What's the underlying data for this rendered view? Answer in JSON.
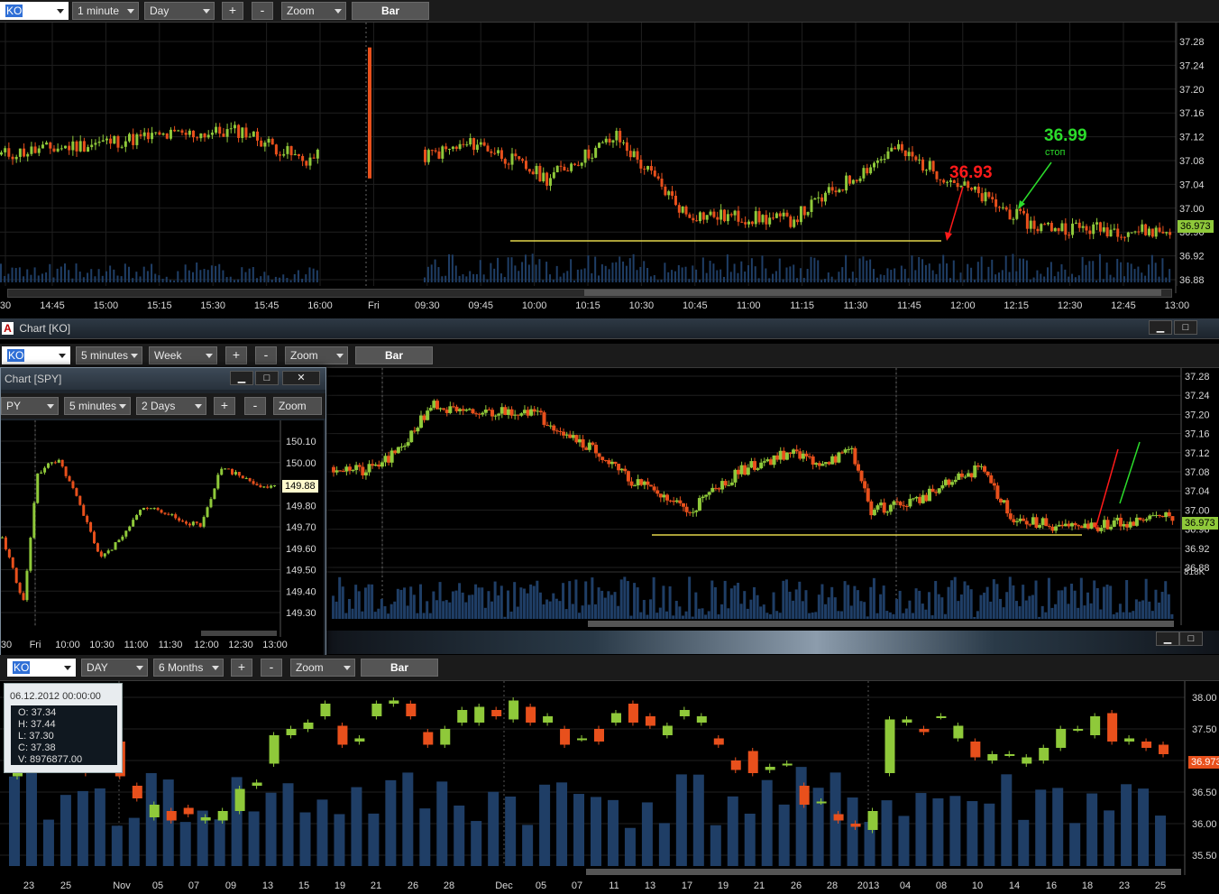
{
  "colors": {
    "up": "#8fc93a",
    "down": "#e8501c",
    "support": "#e3d64a",
    "red_annot": "#ff1a1a",
    "green_annot": "#2bdc2b",
    "volume": "#1f3e66",
    "grid": "#1f1f1f",
    "background": "#000000"
  },
  "top": {
    "toolbar": {
      "symbol": "KO",
      "interval": "1 minute",
      "period": "Day",
      "plus": "+",
      "minus": "-",
      "zoom": "Zoom",
      "bar": "Bar"
    },
    "price_axis": [
      "37.28",
      "37.24",
      "37.20",
      "37.16",
      "37.12",
      "37.08",
      "37.04",
      "37.00",
      "36.96",
      "36.92",
      "36.88"
    ],
    "time_axis": [
      "30",
      "14:45",
      "15:00",
      "15:15",
      "15:30",
      "15:45",
      "16:00",
      "Fri",
      "09:30",
      "09:45",
      "10:00",
      "10:15",
      "10:30",
      "10:45",
      "11:00",
      "11:15",
      "11:30",
      "11:45",
      "12:00",
      "12:15",
      "12:30",
      "12:45",
      "13:00"
    ],
    "last_price": "36.973",
    "annotations": {
      "entry_price": "36.93",
      "stop_price": "36.99",
      "stop_word": "стоп"
    }
  },
  "middle": {
    "title": "Chart [KO]",
    "toolbar": {
      "symbol": "KO",
      "interval": "5 minutes",
      "period": "Week",
      "plus": "+",
      "minus": "-",
      "zoom": "Zoom",
      "bar": "Bar"
    },
    "price_axis": [
      "37.28",
      "37.24",
      "37.20",
      "37.16",
      "37.12",
      "37.08",
      "37.04",
      "37.00",
      "36.96",
      "36.92",
      "36.88"
    ],
    "volume_label": "818K",
    "last_price": "36.973"
  },
  "spy": {
    "title": "Chart [SPY]",
    "toolbar": {
      "symbol": "PY",
      "interval": "5 minutes",
      "period": "2 Days",
      "plus": "+",
      "minus": "-",
      "zoom": "Zoom"
    },
    "price_axis": [
      "150.10",
      "150.00",
      "149.90",
      "149.80",
      "149.70",
      "149.60",
      "149.50",
      "149.40",
      "149.30"
    ],
    "time_axis": [
      "30",
      "Fri",
      "10:00",
      "10:30",
      "11:00",
      "11:30",
      "12:00",
      "12:30",
      "13:00"
    ],
    "last_price": "149.88"
  },
  "bottom": {
    "toolbar": {
      "symbol": "KO",
      "interval": "DAY",
      "period": "6 Months",
      "plus": "+",
      "minus": "-",
      "zoom": "Zoom",
      "bar": "Bar"
    },
    "price_axis": [
      "38.00",
      "37.50",
      "37.00",
      "36.50",
      "36.00",
      "35.50"
    ],
    "time_axis": [
      "23",
      "25",
      "Nov",
      "05",
      "07",
      "09",
      "13",
      "15",
      "19",
      "21",
      "26",
      "28",
      "Dec",
      "05",
      "07",
      "11",
      "13",
      "17",
      "19",
      "21",
      "26",
      "28",
      "2013",
      "04",
      "08",
      "10",
      "14",
      "16",
      "18",
      "23",
      "25"
    ],
    "last_price": "36.973",
    "tooltip": {
      "date": "06.12.2012 00:00:00",
      "open": "O: 37.34",
      "high": "H: 37.44",
      "low": "L: 37.30",
      "close": "C: 37.38",
      "volume": "V: 8976877.00"
    }
  }
}
